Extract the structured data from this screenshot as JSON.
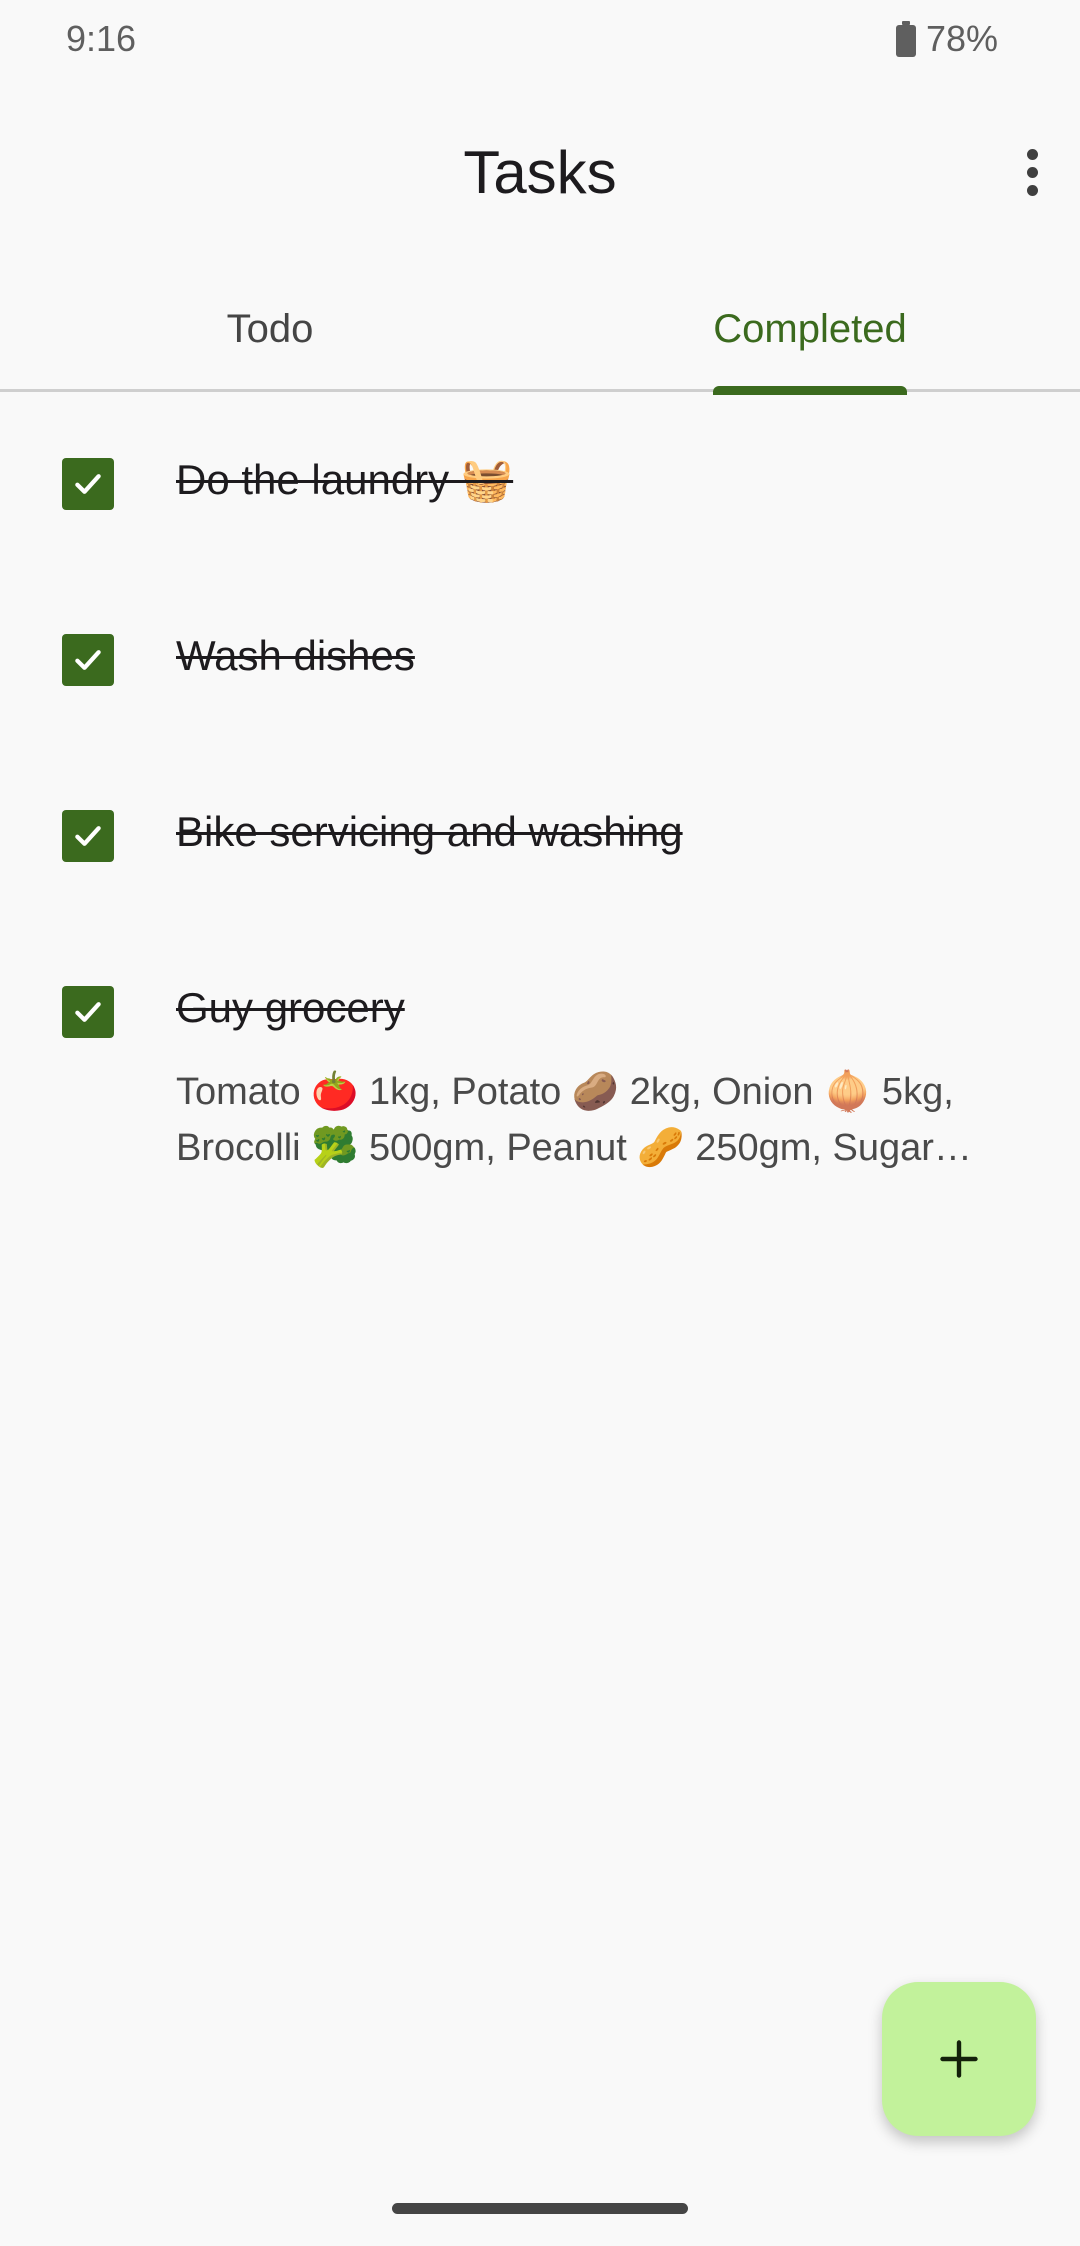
{
  "status_bar": {
    "time": "9:16",
    "battery": "78%"
  },
  "app_bar": {
    "title": "Tasks"
  },
  "tabs": [
    {
      "label": "Todo",
      "selected": false
    },
    {
      "label": "Completed",
      "selected": true
    }
  ],
  "tasks": [
    {
      "title": "Do the laundry 🧺",
      "completed": true,
      "description": ""
    },
    {
      "title": "Wash dishes ",
      "completed": true,
      "description": ""
    },
    {
      "title": "Bike servicing and washing",
      "completed": true,
      "description": ""
    },
    {
      "title": "Guy grocery",
      "completed": true,
      "description": "Tomato 🍅 1kg, Potato 🥔 2kg, Onion 🧅 5kg, Brocolli 🥦 500gm, Peanut 🥜 250gm, Sugar…"
    }
  ],
  "colors": {
    "accent": "#3b6a1e",
    "fab": "#c2f29b",
    "background": "#f9f9f9"
  },
  "icons": {
    "more": "more-vert-icon",
    "checkbox": "check-icon",
    "fab": "add-icon"
  }
}
